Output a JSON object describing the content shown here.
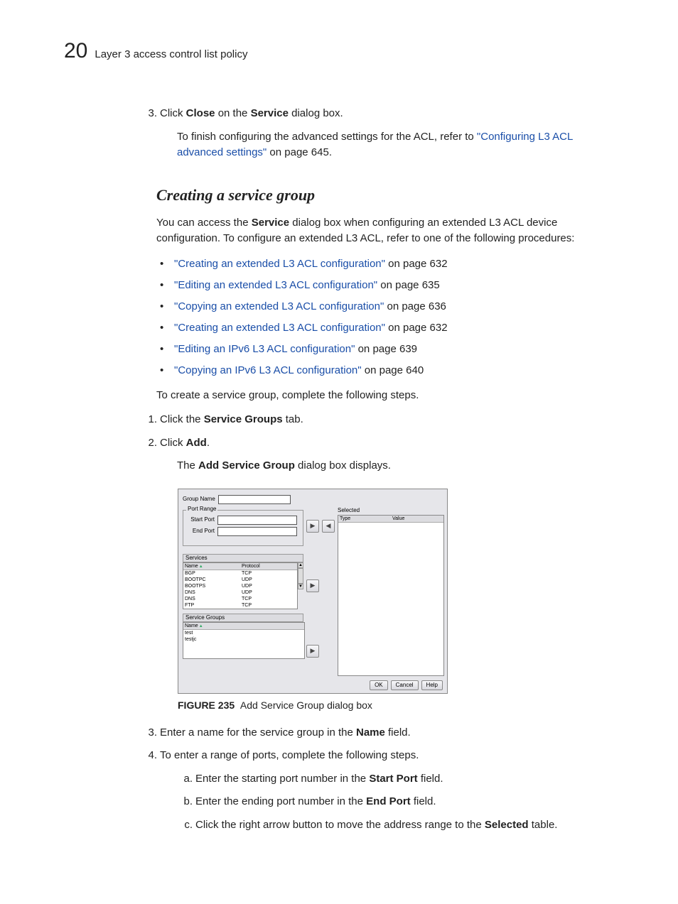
{
  "header": {
    "chapter_num": "20",
    "section": "Layer 3 access control list policy"
  },
  "step3": {
    "marker": "3.",
    "pre": "Click ",
    "bold1": "Close",
    "mid": " on the ",
    "bold2": "Service",
    "post": " dialog box."
  },
  "step3_note": {
    "pre": "To finish configuring the advanced settings for the ACL, refer to ",
    "link": "\"Configuring L3 ACL advanced settings\"",
    "post": " on page 645."
  },
  "subhead": "Creating a service group",
  "intro": {
    "pre": "You can access the ",
    "bold": "Service",
    "post": " dialog box when configuring an extended L3 ACL device configuration. To configure an extended L3 ACL, refer to one of the following procedures:"
  },
  "links": [
    {
      "text": "\"Creating an extended L3 ACL configuration\"",
      "page": " on page 632"
    },
    {
      "text": "\"Editing an extended L3 ACL configuration\"",
      "page": " on page 635"
    },
    {
      "text": "\"Copying an extended L3 ACL configuration\"",
      "page": " on page 636"
    },
    {
      "text": "\"Creating an extended L3 ACL configuration\"",
      "page": " on page 632"
    },
    {
      "text": "\"Editing an IPv6 L3 ACL configuration\"",
      "page": " on page 639"
    },
    {
      "text": "\"Copying an IPv6 L3 ACL configuration\"",
      "page": " on page 640"
    }
  ],
  "create_line": "To create a service group, complete the following steps.",
  "steps": {
    "s1": {
      "marker": "1.",
      "pre": "Click the ",
      "bold": "Service Groups",
      "post": " tab."
    },
    "s2": {
      "marker": "2.",
      "pre": "Click ",
      "bold": "Add",
      "post": "."
    },
    "s2_note": {
      "pre": "The ",
      "bold": "Add Service Group",
      "post": " dialog box displays."
    },
    "s3": {
      "marker": "3.",
      "pre": "Enter a name for the service group in the ",
      "bold": "Name",
      "post": " field."
    },
    "s4": {
      "marker": "4.",
      "text": "To enter a range of ports, complete the following steps."
    },
    "s4a": {
      "marker": "a.",
      "pre": "Enter the starting port number in the ",
      "bold": "Start Port",
      "post": " field."
    },
    "s4b": {
      "marker": "b.",
      "pre": "Enter the ending port number in the ",
      "bold": "End Port",
      "post": " field."
    },
    "s4c": {
      "marker": "c.",
      "pre": "Click the right arrow button to move the address range to the ",
      "bold": "Selected",
      "post": " table."
    }
  },
  "dialog": {
    "group_name_label": "Group Name",
    "port_range": {
      "title": "Port Range",
      "start": "Start Port",
      "end": "End Port"
    },
    "services": {
      "title": "Services",
      "name": "Name",
      "protocol": "Protocol",
      "rows": [
        {
          "n": "BGP",
          "p": "TCP"
        },
        {
          "n": "BOOTPC",
          "p": "UDP"
        },
        {
          "n": "BOOTPS",
          "p": "UDP"
        },
        {
          "n": "DNS",
          "p": "UDP"
        },
        {
          "n": "DNS",
          "p": "TCP"
        },
        {
          "n": "FTP",
          "p": "TCP"
        }
      ]
    },
    "service_groups": {
      "title": "Service Groups",
      "name": "Name",
      "rows": [
        "test",
        "testjc"
      ]
    },
    "selected": {
      "title": "Selected",
      "type": "Type",
      "value": "Value"
    },
    "buttons": {
      "ok": "OK",
      "cancel": "Cancel",
      "help": "Help"
    }
  },
  "figure": {
    "num": "FIGURE 235",
    "caption": "Add Service Group dialog box"
  }
}
